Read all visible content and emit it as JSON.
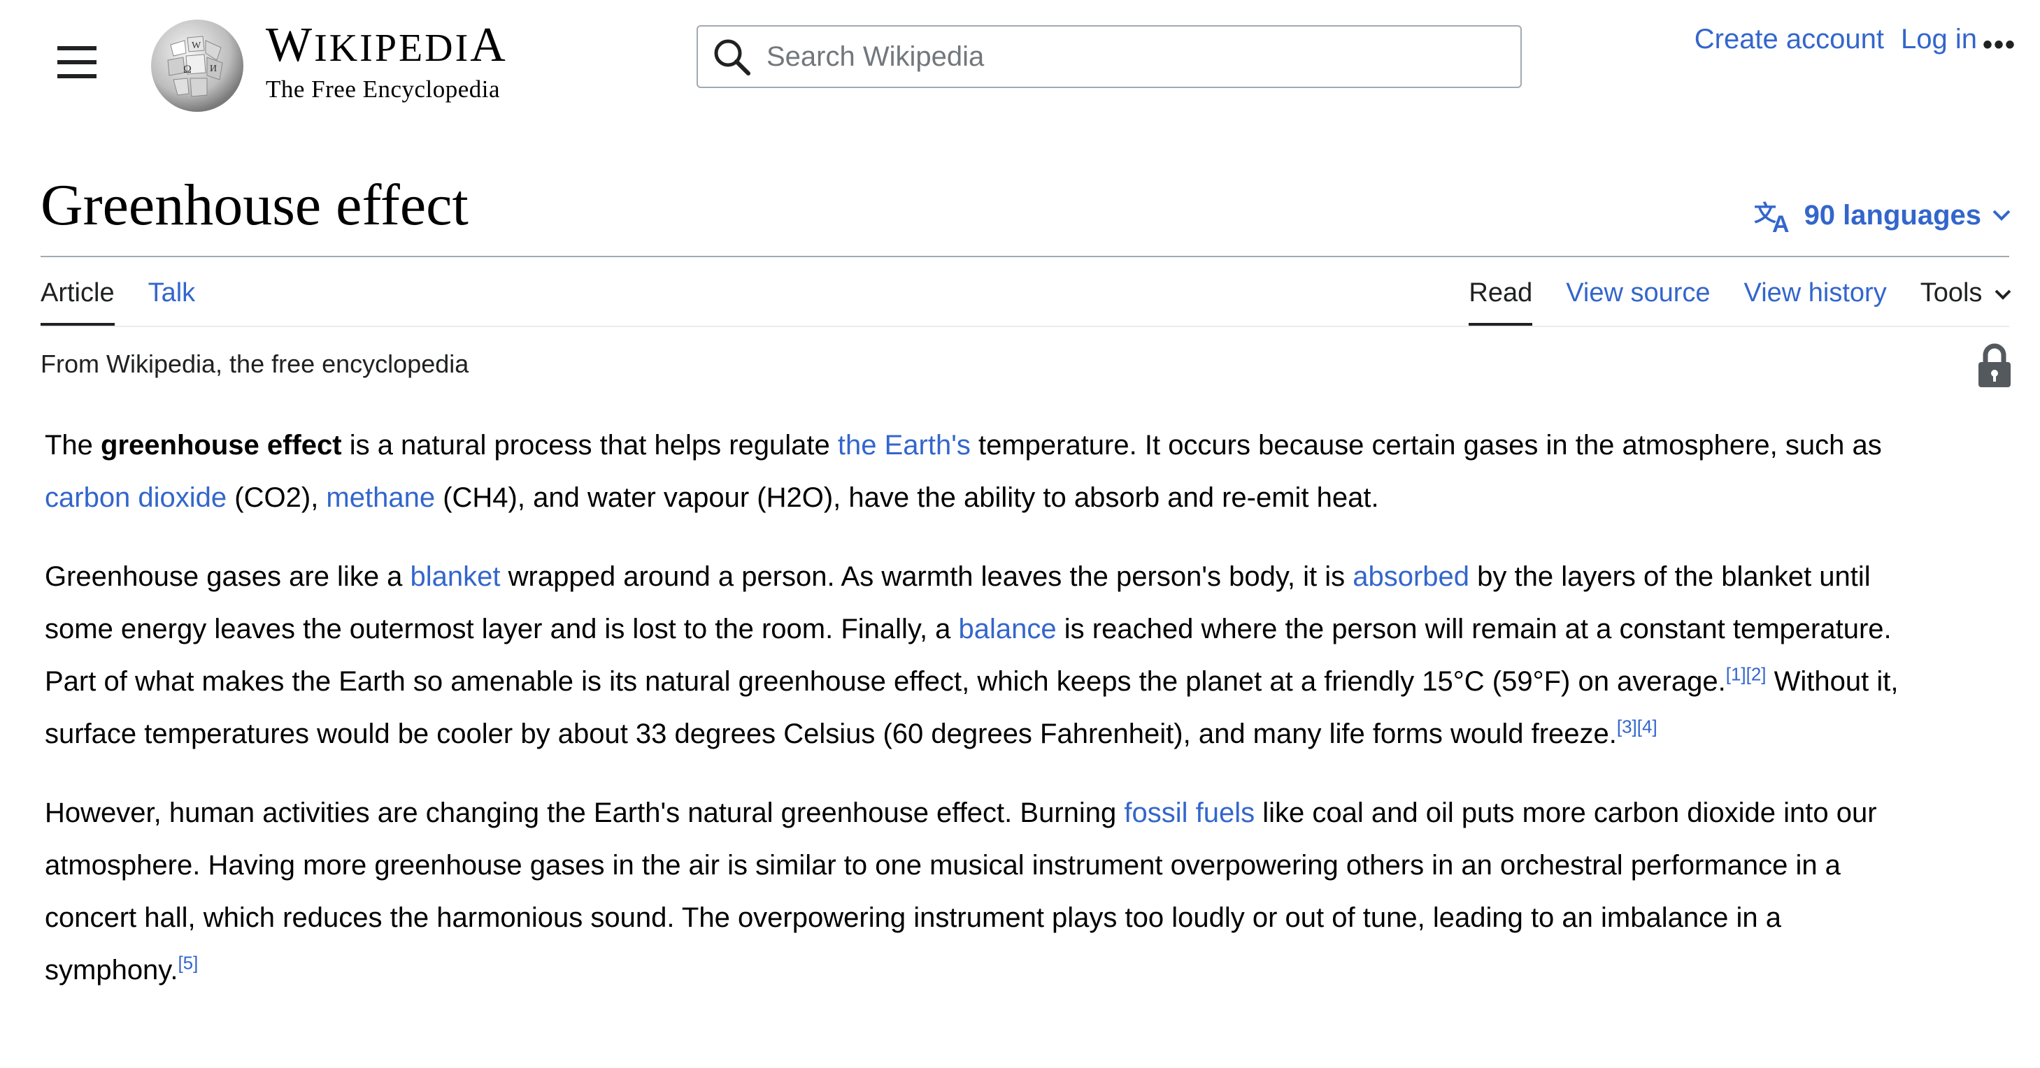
{
  "header": {
    "menu_icon": "hamburger-menu-icon",
    "logo_icon": "wikipedia-globe-icon",
    "wordmark": "Wikipedia",
    "tagline": "The Free Encyclopedia",
    "search_placeholder": "Search Wikipedia",
    "search_icon": "search-icon",
    "create_account": "Create account",
    "log_in": "Log in",
    "more_icon": "ellipsis-icon",
    "more": "•••"
  },
  "page": {
    "title": "Greenhouse effect",
    "languages": "90 languages",
    "language_icon": "translate-icon",
    "chevron_icon": "chevron-down-icon"
  },
  "tabs": {
    "left": [
      "Article",
      "Talk"
    ],
    "right": [
      "Read",
      "View source",
      "View history",
      "Tools"
    ]
  },
  "from_line": "From Wikipedia, the free encyclopedia",
  "lock_icon": "lock-icon",
  "article": {
    "p1": {
      "t1": "The ",
      "bold": "greenhouse effect",
      "t2": " is a natural process that helps regulate ",
      "link1": "the Earth's",
      "t3": " temperature. It occurs because certain gases in the atmosphere, such as ",
      "link2": "carbon dioxide",
      "t4": " (CO2), ",
      "link3": "methane",
      "t5": " (CH4), and water vapour (H2O), have the ability to absorb and re-emit heat."
    },
    "p2": {
      "t1": "Greenhouse gases are like a ",
      "link1": "blanket",
      "t2": " wrapped around a person. As warmth leaves the person's body, it is ",
      "link2": "absorbed",
      "t3": " by the layers of the blanket until some energy leaves the outermost layer and is lost to the room. Finally, a ",
      "link3": "balance",
      "t4": " is reached where the person will remain at a constant temperature. Part of what makes the Earth so amenable is its natural greenhouse effect, which keeps the planet at a friendly 15°C (59°F) on average.",
      "ref1": "[1][2]",
      "t5": " Without it, surface temperatures would be cooler by about 33 degrees Celsius (60 degrees Fahrenheit), and many life forms would freeze.",
      "ref2": "[3][4]"
    },
    "p3": {
      "t1": "However, human activities are changing the Earth's natural greenhouse effect. Burning ",
      "link1": "fossil fuels",
      "t2": " like coal and oil puts more carbon dioxide into our atmosphere. Having more greenhouse gases in the air is similar to one musical instrument overpowering others in an orchestral performance in a concert hall, which reduces the harmonious sound. The overpowering instrument plays too loudly or out of tune, leading to an imbalance in a symphony.",
      "ref1": "[5]"
    }
  },
  "colors": {
    "link": "#3366cc",
    "text": "#202122",
    "border": "#a2a9b1"
  }
}
